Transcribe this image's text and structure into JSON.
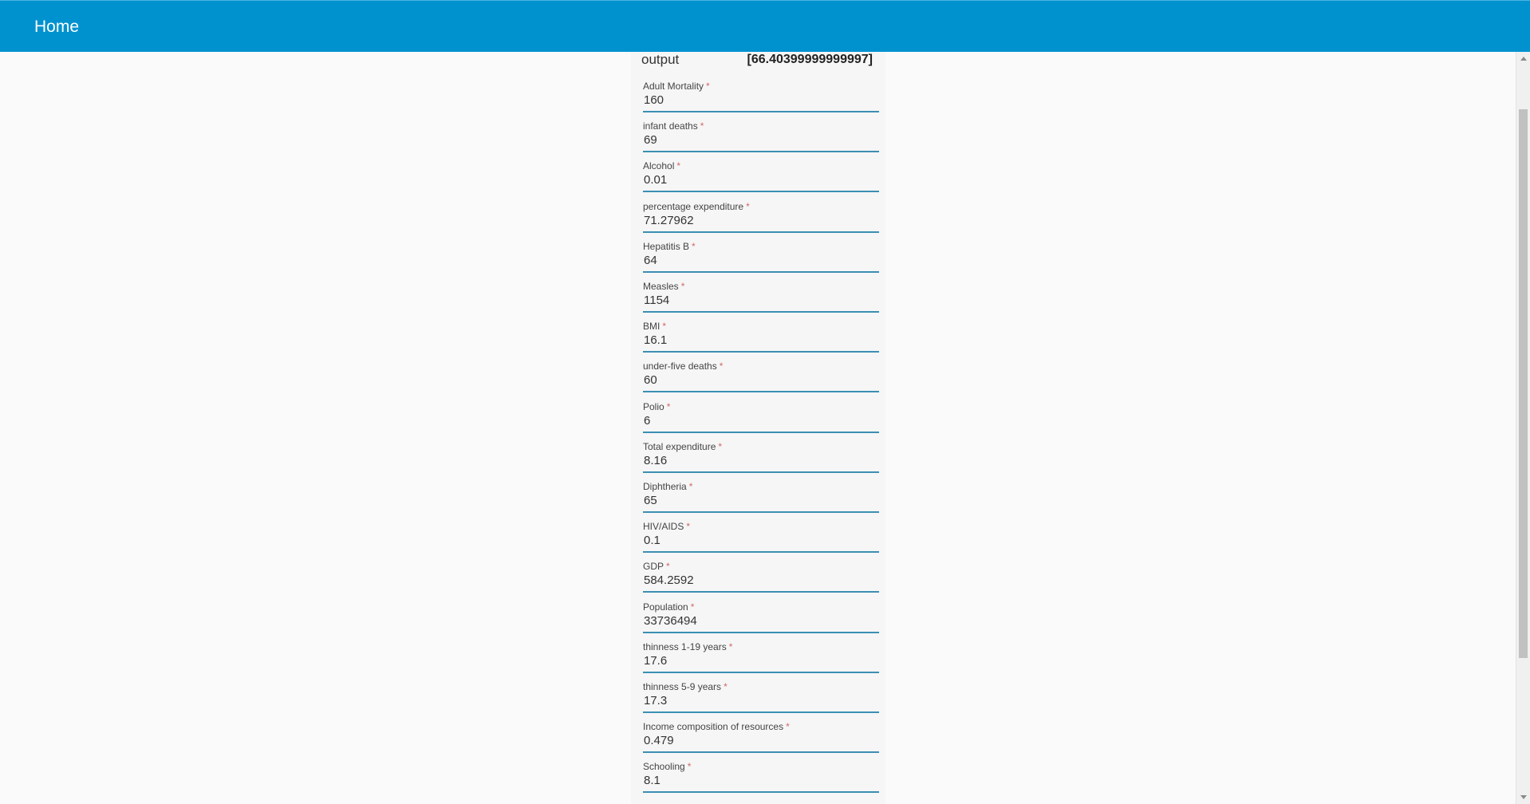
{
  "header": {
    "home_label": "Home"
  },
  "output": {
    "label": "output",
    "value": "[66.40399999999997]"
  },
  "fields": [
    {
      "label": "Adult Mortality",
      "value": "160"
    },
    {
      "label": "infant deaths",
      "value": "69"
    },
    {
      "label": "Alcohol",
      "value": "0.01"
    },
    {
      "label": "percentage expenditure",
      "value": "71.27962"
    },
    {
      "label": "Hepatitis B",
      "value": "64"
    },
    {
      "label": "Measles",
      "value": "1154"
    },
    {
      "label": "BMI",
      "value": "16.1"
    },
    {
      "label": "under-five deaths",
      "value": "60"
    },
    {
      "label": "Polio",
      "value": "6"
    },
    {
      "label": "Total expenditure",
      "value": "8.16"
    },
    {
      "label": "Diphtheria",
      "value": "65"
    },
    {
      "label": "HIV/AIDS",
      "value": "0.1"
    },
    {
      "label": "GDP",
      "value": "584.2592"
    },
    {
      "label": "Population",
      "value": "33736494"
    },
    {
      "label": "thinness 1-19 years",
      "value": "17.6"
    },
    {
      "label": "thinness 5-9 years",
      "value": "17.3"
    },
    {
      "label": "Income composition of resources",
      "value": "0.479"
    },
    {
      "label": "Schooling",
      "value": "8.1"
    }
  ],
  "required_marker": "*",
  "colors": {
    "header_bg": "#0092cf",
    "underline": "#3b8fb3",
    "required": "#d06a6a"
  }
}
